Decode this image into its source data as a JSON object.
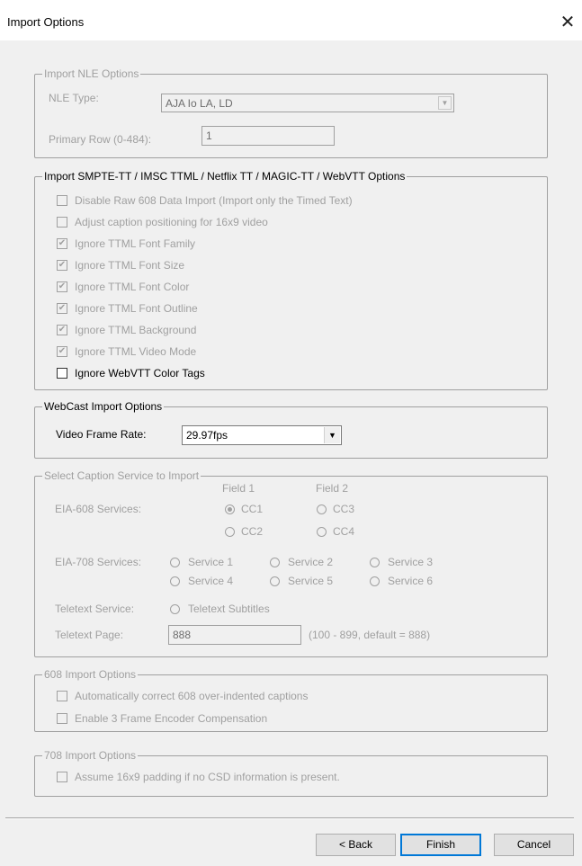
{
  "window": {
    "title": "Import Options",
    "close_glyph": "✕"
  },
  "nle": {
    "legend": "Import NLE Options",
    "type_label": "NLE Type:",
    "type_value": "AJA Io LA, LD",
    "primary_row_label": "Primary Row (0-484):",
    "primary_row_value": "1"
  },
  "smpte": {
    "legend": "Import SMPTE-TT / IMSC TTML / Netflix TT / MAGIC-TT / WebVTT Options",
    "options": [
      {
        "label": "Disable Raw 608 Data Import (Import only the Timed Text)",
        "checked": false,
        "enabled": false
      },
      {
        "label": "Adjust caption positioning for 16x9 video",
        "checked": false,
        "enabled": false
      },
      {
        "label": "Ignore TTML Font Family",
        "checked": true,
        "enabled": false
      },
      {
        "label": "Ignore TTML Font Size",
        "checked": true,
        "enabled": false
      },
      {
        "label": "Ignore TTML Font Color",
        "checked": true,
        "enabled": false
      },
      {
        "label": "Ignore TTML Font Outline",
        "checked": true,
        "enabled": false
      },
      {
        "label": "Ignore TTML Background",
        "checked": true,
        "enabled": false
      },
      {
        "label": "Ignore TTML Video Mode",
        "checked": true,
        "enabled": false
      },
      {
        "label": "Ignore WebVTT Color Tags",
        "checked": false,
        "enabled": true
      }
    ]
  },
  "webcast": {
    "legend": "WebCast Import Options",
    "frame_rate_label": "Video Frame Rate:",
    "frame_rate_value": "29.97fps"
  },
  "caption_service": {
    "legend": "Select Caption Service to Import",
    "field1": "Field 1",
    "field2": "Field 2",
    "eia608_label": "EIA-608 Services:",
    "cc1": "CC1",
    "cc2": "CC2",
    "cc3": "CC3",
    "cc4": "CC4",
    "eia708_label": "EIA-708 Services:",
    "service1": "Service 1",
    "service2": "Service 2",
    "service3": "Service 3",
    "service4": "Service 4",
    "service5": "Service 5",
    "service6": "Service 6",
    "teletext_service_label": "Teletext Service:",
    "teletext_subtitles": "Teletext Subtitles",
    "teletext_page_label": "Teletext Page:",
    "teletext_page_value": "888",
    "teletext_page_hint": "(100 - 899, default = 888)"
  },
  "import608": {
    "legend": "608 Import Options",
    "opt1": "Automatically correct 608 over-indented captions",
    "opt2": "Enable 3 Frame Encoder Compensation"
  },
  "import708": {
    "legend": "708 Import Options",
    "opt1": "Assume 16x9 padding if no CSD information is present."
  },
  "buttons": {
    "back": "< Back",
    "finish": "Finish",
    "cancel": "Cancel"
  },
  "glyphs": {
    "check": "✔",
    "dropdown_arrow": "▼"
  }
}
